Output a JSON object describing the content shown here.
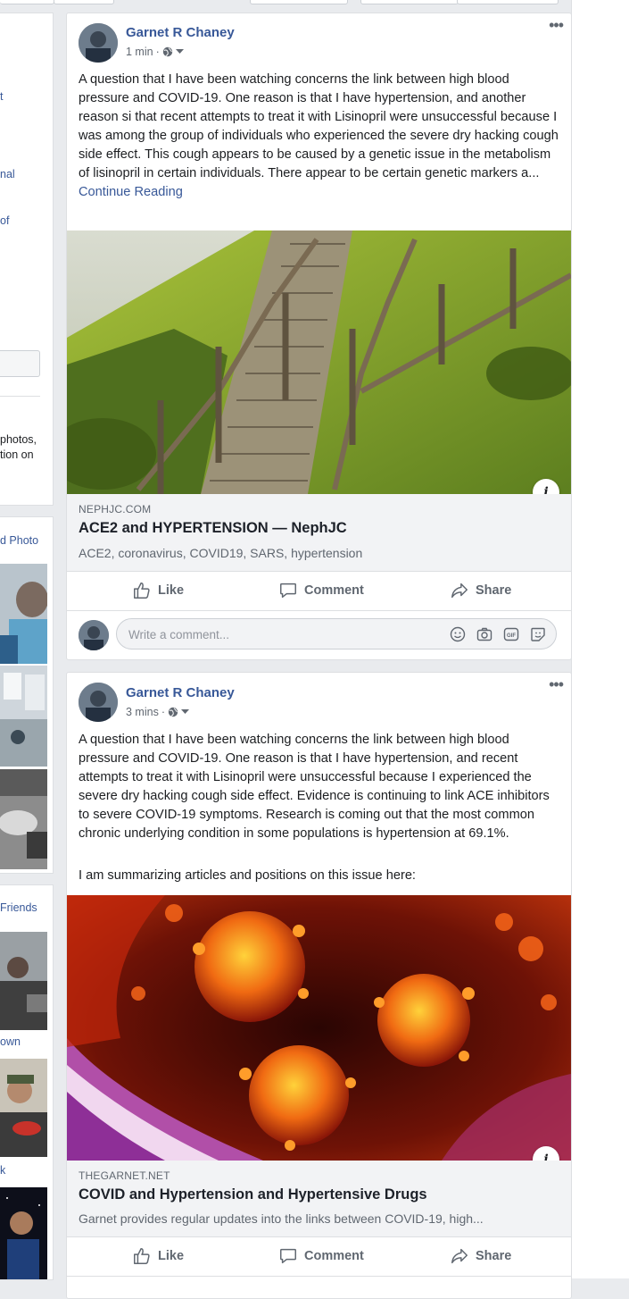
{
  "left_column": {
    "fragments": [
      "t",
      "nal",
      "of",
      "photos,",
      "tion on",
      "d Photo",
      "Friends",
      "own",
      "k"
    ]
  },
  "posts": [
    {
      "author": "Garnet R Chaney",
      "time": "1 min",
      "text": "A question that I have been watching concerns the link between high blood pressure and COVID-19. One reason is that I have hypertension, and another reason si that recent attempts to treat it with Lisinopril were unsuccessful because I was among the group of individuals who experienced the severe dry hacking cough side effect. This cough appears to be caused by a genetic issue in the metabolism of lisinopril in certain individuals. There appear to be certain genetic markers a...",
      "continue_label": "Continue Reading",
      "link": {
        "domain": "NEPHJC.COM",
        "title": "ACE2 and HYPERTENSION — NephJC",
        "description": "ACE2, coronavirus, COVID19, SARS, hypertension"
      },
      "actions": {
        "like": "Like",
        "comment": "Comment",
        "share": "Share"
      },
      "comment_placeholder": "Write a comment..."
    },
    {
      "author": "Garnet R Chaney",
      "time": "3 mins",
      "text": "A question that I have been watching concerns the link between high blood pressure and COVID-19. One reason is that I have hypertension, and recent attempts to treat it with Lisinopril were unsuccessful because I experienced the severe dry hacking cough side effect. Evidence is continuing to link ACE inhibitors to severe COVID-19 symptoms. Research is coming out that the most common chronic underlying condition in some populations is hypertension at 69.1%.",
      "text2": "I am summarizing articles and positions on this issue here:",
      "link": {
        "domain": "THEGARNET.NET",
        "title": "COVID and Hypertension and Hypertensive Drugs",
        "description": "Garnet provides regular updates into the links between COVID-19, high..."
      },
      "actions": {
        "like": "Like",
        "comment": "Comment",
        "share": "Share"
      }
    }
  ],
  "icons": [
    "globe-icon",
    "caret-down-icon",
    "more-icon",
    "info-icon",
    "like-icon",
    "comment-icon",
    "share-icon",
    "emoji-icon",
    "camera-icon",
    "gif-icon",
    "sticker-icon"
  ],
  "colors": {
    "link": "#385898",
    "background": "#e9ebee",
    "secondary_text": "#606770"
  }
}
